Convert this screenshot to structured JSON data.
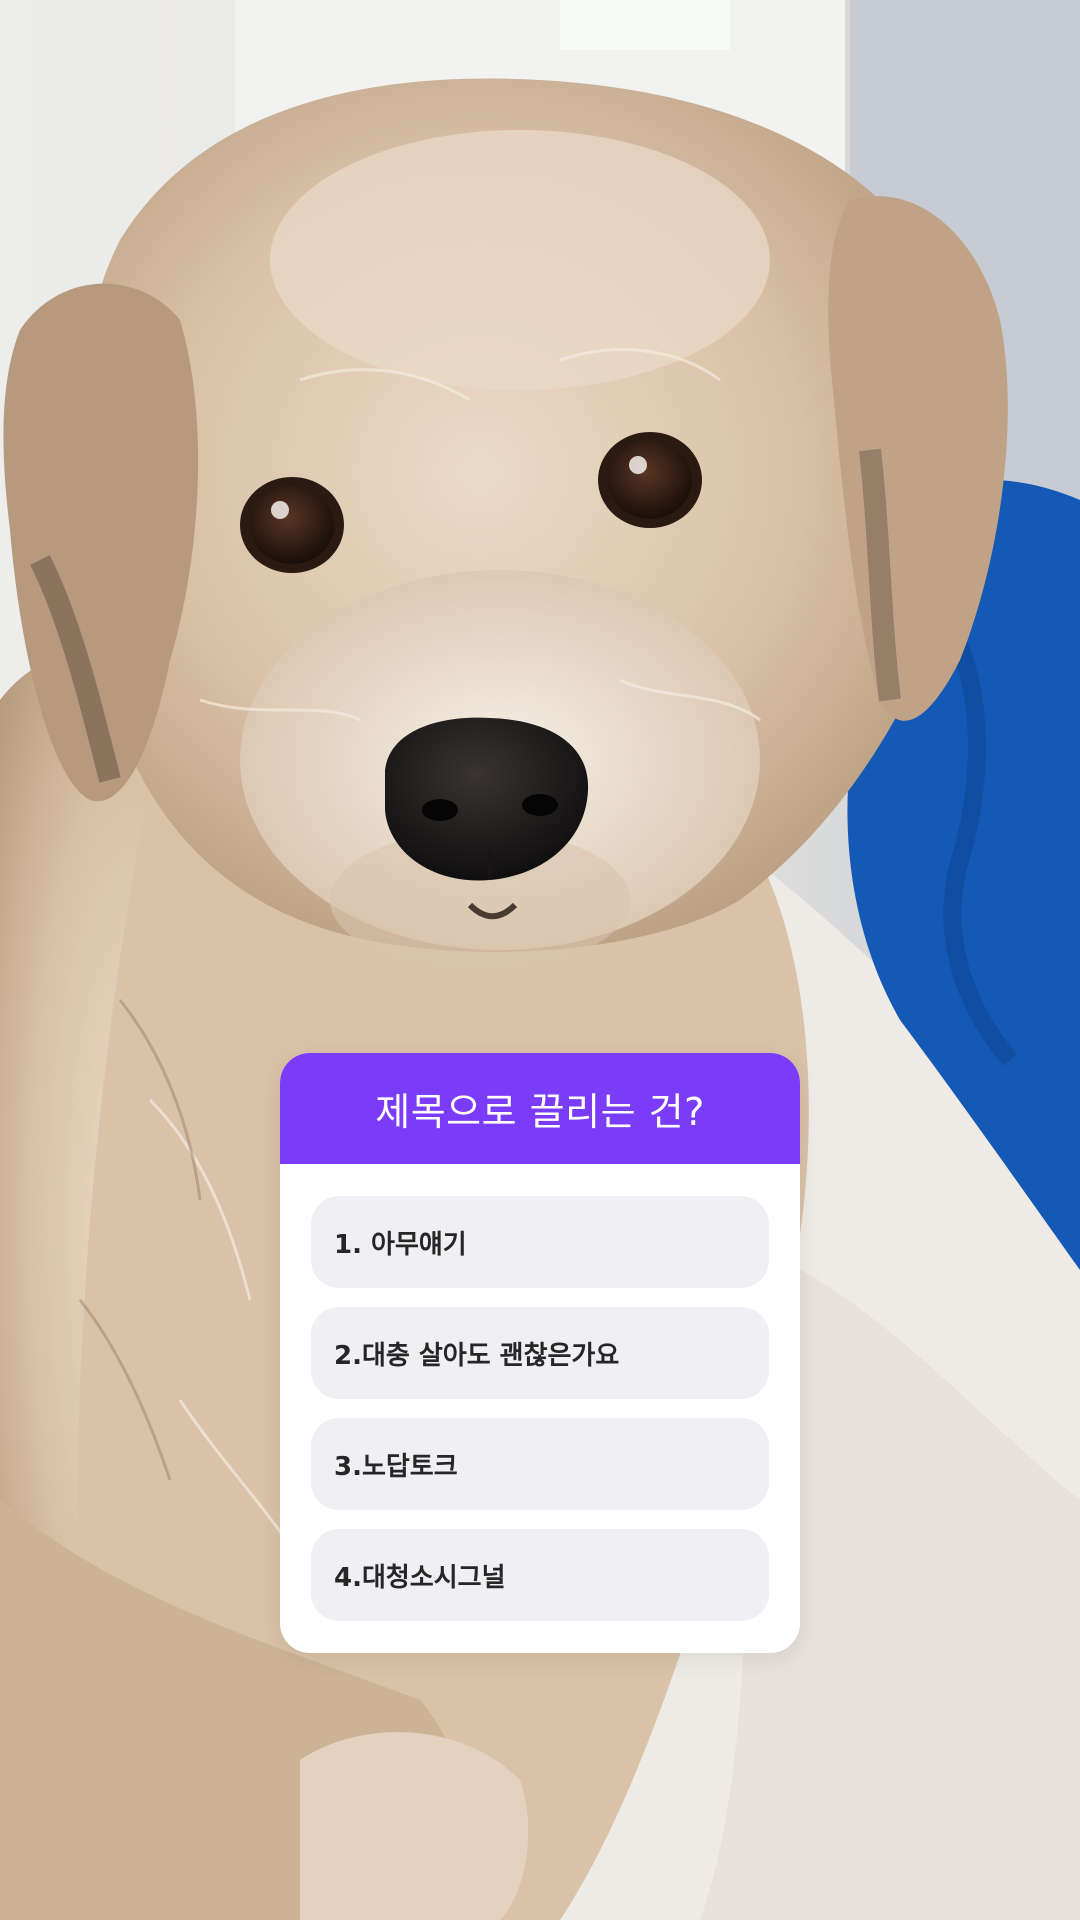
{
  "quiz": {
    "title": "제목으로 끌리는 건?",
    "options": [
      {
        "label": "1. 아무얘기"
      },
      {
        "label": "2.대충 살아도 괜찮은가요"
      },
      {
        "label": "3.노답토크"
      },
      {
        "label": "4.대청소시그널"
      }
    ]
  },
  "colors": {
    "quiz_header": "#7b3cfa",
    "option_background": "#f0f0f4",
    "blanket": "#1459b5",
    "fur": "#d7bfa4"
  },
  "icons": {
    "background": "dog-photo"
  }
}
